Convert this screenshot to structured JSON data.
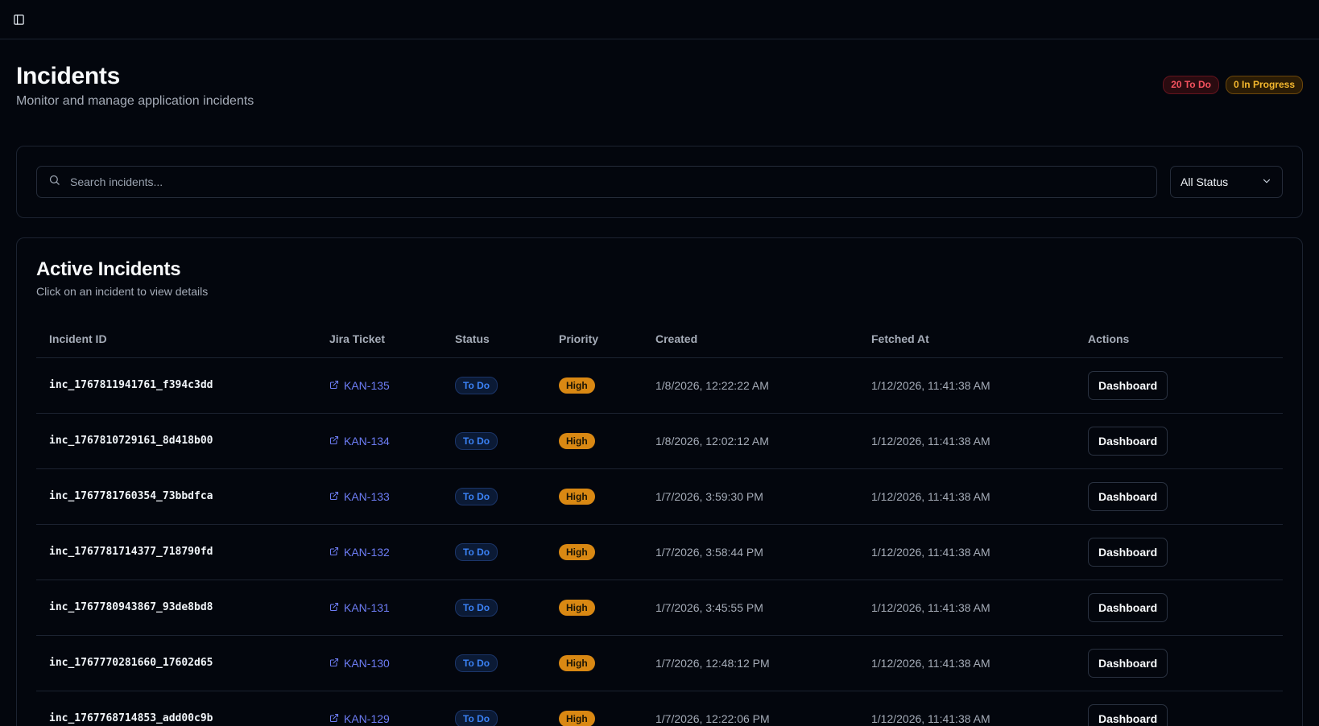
{
  "header": {
    "title": "Incidents",
    "subtitle": "Monitor and manage application incidents",
    "badge_todo": "20 To Do",
    "badge_in_progress": "0 In Progress"
  },
  "filters": {
    "search_placeholder": "Search incidents...",
    "status_select": "All Status"
  },
  "table_card": {
    "title": "Active Incidents",
    "subtitle": "Click on an incident to view details",
    "columns": [
      "Incident ID",
      "Jira Ticket",
      "Status",
      "Priority",
      "Created",
      "Fetched At",
      "Actions"
    ],
    "rows": [
      {
        "id": "inc_1767811941761_f394c3dd",
        "jira": "KAN-135",
        "status": "To Do",
        "priority": "High",
        "created": "1/8/2026, 12:22:22 AM",
        "fetched": "1/12/2026, 11:41:38 AM",
        "action": "Dashboard"
      },
      {
        "id": "inc_1767810729161_8d418b00",
        "jira": "KAN-134",
        "status": "To Do",
        "priority": "High",
        "created": "1/8/2026, 12:02:12 AM",
        "fetched": "1/12/2026, 11:41:38 AM",
        "action": "Dashboard"
      },
      {
        "id": "inc_1767781760354_73bbdfca",
        "jira": "KAN-133",
        "status": "To Do",
        "priority": "High",
        "created": "1/7/2026, 3:59:30 PM",
        "fetched": "1/12/2026, 11:41:38 AM",
        "action": "Dashboard"
      },
      {
        "id": "inc_1767781714377_718790fd",
        "jira": "KAN-132",
        "status": "To Do",
        "priority": "High",
        "created": "1/7/2026, 3:58:44 PM",
        "fetched": "1/12/2026, 11:41:38 AM",
        "action": "Dashboard"
      },
      {
        "id": "inc_1767780943867_93de8bd8",
        "jira": "KAN-131",
        "status": "To Do",
        "priority": "High",
        "created": "1/7/2026, 3:45:55 PM",
        "fetched": "1/12/2026, 11:41:38 AM",
        "action": "Dashboard"
      },
      {
        "id": "inc_1767770281660_17602d65",
        "jira": "KAN-130",
        "status": "To Do",
        "priority": "High",
        "created": "1/7/2026, 12:48:12 PM",
        "fetched": "1/12/2026, 11:41:38 AM",
        "action": "Dashboard"
      },
      {
        "id": "inc_1767768714853_add00c9b",
        "jira": "KAN-129",
        "status": "To Do",
        "priority": "High",
        "created": "1/7/2026, 12:22:06 PM",
        "fetched": "1/12/2026, 11:41:38 AM",
        "action": "Dashboard"
      }
    ]
  },
  "icons": {
    "sidebar_toggle": "sidebar-toggle-icon",
    "search": "search-icon",
    "chevron": "chevron-down-icon",
    "external_link": "external-link-icon"
  },
  "colors": {
    "background": "#03060d",
    "todo_badge": "#f5525f",
    "in_progress_badge": "#f5b82e",
    "link": "#6d7df5",
    "priority_high": "#d98813",
    "status_todo": "#3b82f6"
  }
}
